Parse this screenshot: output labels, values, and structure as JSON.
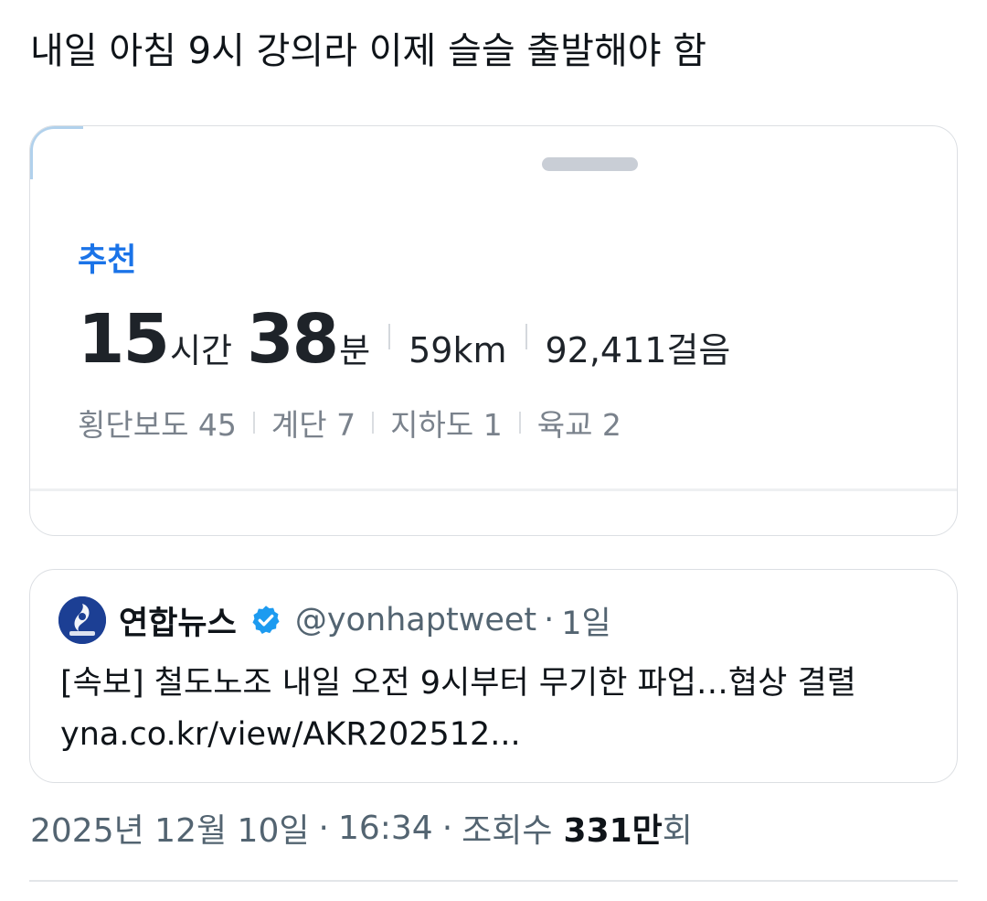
{
  "tweet": {
    "text": "내일 아침 9시 강의라 이제 슬슬 출발해야 함"
  },
  "route_card": {
    "label": "추천",
    "hours": "15",
    "hours_unit": "시간",
    "minutes": "38",
    "minutes_unit": "분",
    "distance": "59km",
    "steps": "92,411걸음",
    "facilities": [
      "횡단보도 45",
      "계단 7",
      "지하도 1",
      "육교 2"
    ],
    "accent_color": "#1a73e8"
  },
  "quote": {
    "avatar_icon": "yonhap-logo-icon",
    "avatar_text": "연합뉴스",
    "name": "연합뉴스",
    "verified_icon": "verified-badge-icon",
    "handle": "@yonhaptweet",
    "separator": "·",
    "time": "1일",
    "text": "[속보] 철도노조 내일 오전 9시부터 무기한 파업…협상 결렬",
    "link": "yna.co.kr/view/AKR202512..."
  },
  "meta": {
    "date": "2025년 12월 10일",
    "separator": "·",
    "time": "16:34",
    "views_label": "조회수",
    "views_count": "331만",
    "views_unit": "회"
  }
}
